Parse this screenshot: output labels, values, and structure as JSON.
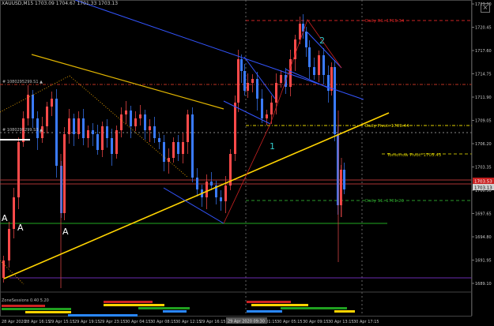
{
  "header": {
    "symbol_line": "XAUUSD,M15  1703.09 1704.67 1701.33 1703.13",
    "close_glyph": "×"
  },
  "colors": {
    "background": "#000000",
    "bull_candle": "#ff4a4a",
    "bear_candle": "#3a7bff",
    "trendline_yellow": "#ffd400",
    "trendline_blue": "#3355ff",
    "pivot": "#e0d000",
    "r1": "#cc2222",
    "s1": "#2a9a2a",
    "support_green": "#22aa22",
    "purple_line": "#6a2bb0"
  },
  "price_axis": {
    "ticks": [
      "1723.30",
      "1720.45",
      "1717.60",
      "1714.75",
      "1711.90",
      "1709.05",
      "1706.20",
      "1703.35",
      "1700.50",
      "1697.65",
      "1694.80",
      "1691.95",
      "1689.10"
    ],
    "current_price": "1703.13",
    "bid_tag": "1703.53"
  },
  "time_axis": {
    "ticks": [
      "28 Apr 2020",
      "28 Apr 16:15",
      "29 Apr 15:15",
      "29 Apr 19:15",
      "29 Apr 23:15",
      "30 Apr 04:15",
      "30 Apr 08:15",
      "30 Apr 12:15",
      "29 Apr 16:15",
      "29 Apr 20:15",
      "30 Apr 01:15",
      "30 Apr 05:15",
      "30 Apr 09:15",
      "30 Apr 13:15",
      "30 Apr 17:15"
    ],
    "highlight_label": "29 Apr 2020 09:30"
  },
  "labels": {
    "r1": "Daily R1: 1715.34",
    "pivot": "Daily Pivot: 1709.44",
    "tomorrow_pivot": "Tomorrow Pivot: 1705.43",
    "s1": "Daily S1: 1701.23",
    "obj1": "# 1080295299.S1 ▲",
    "obj2": "# 1080295299.S3 ▲",
    "wave1": "1",
    "wave2": "2",
    "a1": "A",
    "a2": "A",
    "a3": "A",
    "indicator": "ZoneSessions 0.40 5.20"
  }
}
